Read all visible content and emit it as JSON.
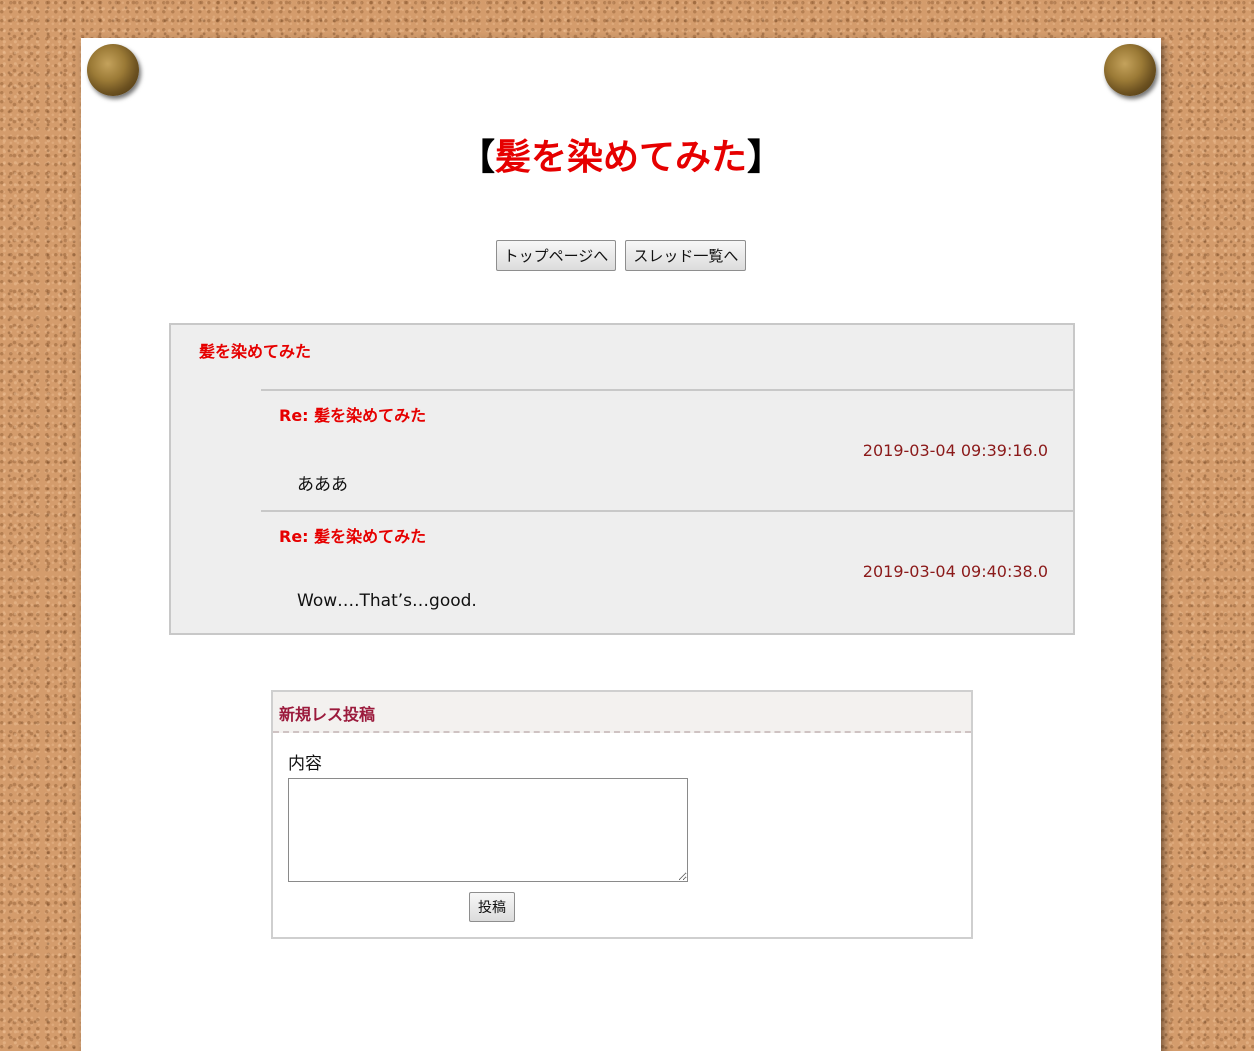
{
  "page": {
    "title_open": "【",
    "title": "髪を染めてみた",
    "title_close": "】"
  },
  "nav": {
    "top_page_label": "トップページへ",
    "thread_list_label": "スレッド一覧へ"
  },
  "thread": {
    "title": "髪を染めてみた",
    "replies": [
      {
        "title": "Re: 髪を染めてみた",
        "date": "2019-03-04 09:39:16.0",
        "body": "あああ"
      },
      {
        "title": "Re: 髪を染めてみた",
        "date": "2019-03-04 09:40:38.0",
        "body": "Wow….That’s…good."
      }
    ]
  },
  "reply_form": {
    "title": "新規レス投稿",
    "content_label": "内容",
    "content_value": "",
    "submit_label": "投稿"
  },
  "colors": {
    "title_red": "#e60000",
    "date_color": "#8b1a1a",
    "form_title_color": "#9b1a3c",
    "cork": "#d49c6c"
  },
  "icons": [
    "push-pin-icon",
    "push-pin-icon"
  ]
}
